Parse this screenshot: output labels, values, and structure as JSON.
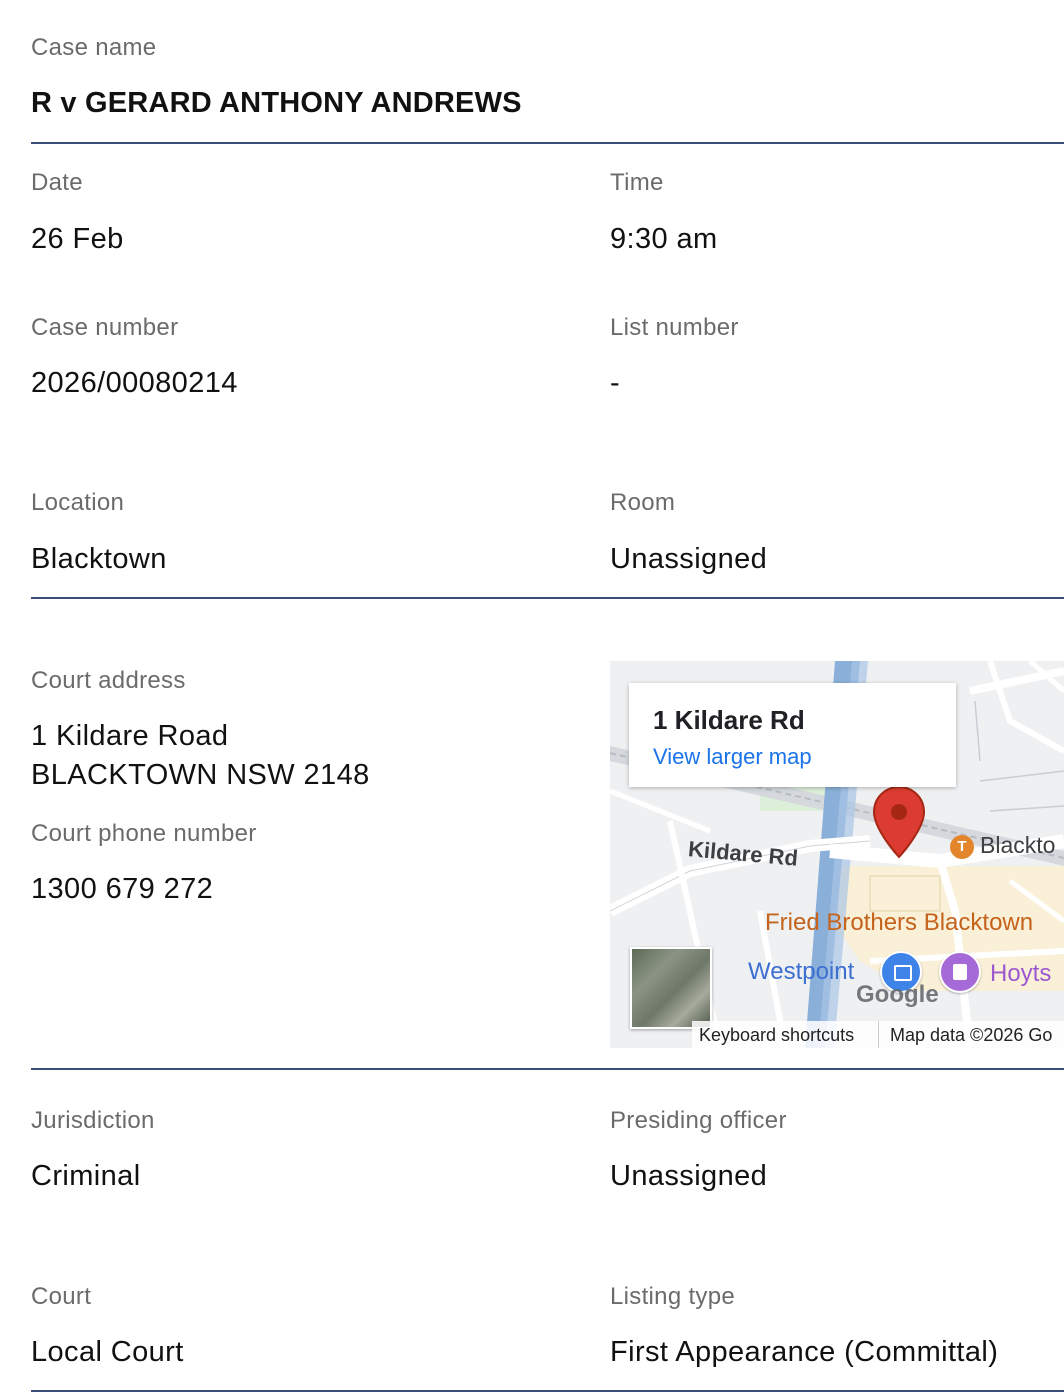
{
  "case_name": {
    "label": "Case name",
    "value": "R v GERARD ANTHONY ANDREWS"
  },
  "date": {
    "label": "Date",
    "value": "26 Feb"
  },
  "time": {
    "label": "Time",
    "value": "9:30 am"
  },
  "case_number": {
    "label": "Case number",
    "value": "2026/00080214"
  },
  "list_number": {
    "label": "List number",
    "value": "-"
  },
  "location": {
    "label": "Location",
    "value": "Blacktown"
  },
  "room": {
    "label": "Room",
    "value": "Unassigned"
  },
  "court_address": {
    "label": "Court address",
    "line1": "1 Kildare Road",
    "line2": "BLACKTOWN NSW 2148"
  },
  "court_phone": {
    "label": "Court phone number",
    "value": "1300 679 272"
  },
  "map": {
    "info_title": "1 Kildare Rd",
    "info_link": "View larger map",
    "street_kildare": "Kildare Rd",
    "station": "Blackto",
    "station_badge": "T",
    "poi_fried": "Fried Brothers Blacktown",
    "poi_westpoint": "Westpoint",
    "poi_hoyts": "Hoyts",
    "google": "Google",
    "keyboard_shortcuts": "Keyboard shortcuts",
    "map_data": "Map data ©2026 Go",
    "pin_icon": "map-pin-icon",
    "colors": {
      "pin": "#db3b30",
      "link": "#1a73e8",
      "poi_orange": "#c5621b",
      "poi_blue": "#3d6fd1",
      "poi_purple": "#9b59d0"
    }
  },
  "jurisdiction": {
    "label": "Jurisdiction",
    "value": "Criminal"
  },
  "presiding_officer": {
    "label": "Presiding officer",
    "value": "Unassigned"
  },
  "court": {
    "label": "Court",
    "value": "Local Court"
  },
  "listing_type": {
    "label": "Listing type",
    "value": "First Appearance (Committal)"
  },
  "colors": {
    "divider": "#3a4d74",
    "label": "#6b6b6b",
    "value": "#111111"
  }
}
